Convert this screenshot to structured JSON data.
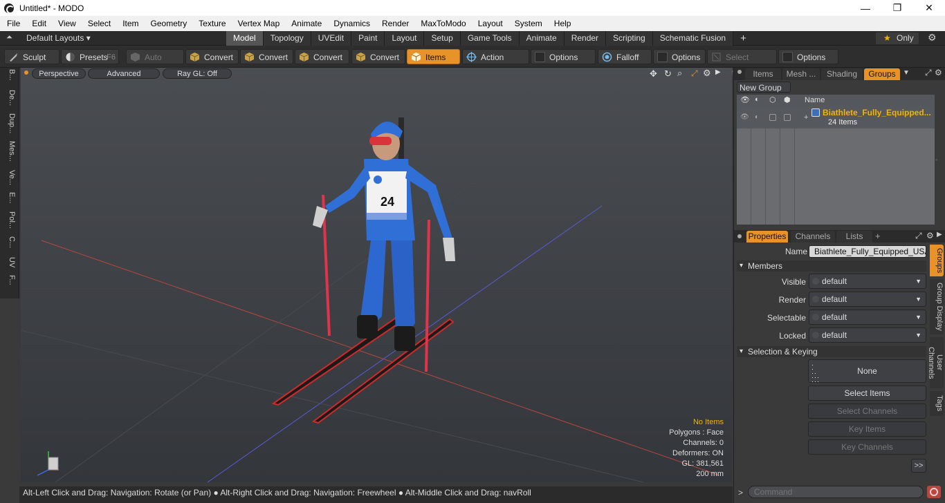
{
  "window": {
    "title": "Untitled* - MODO",
    "minimize": "—",
    "maximize": "❐",
    "close": "✕"
  },
  "menu": [
    "File",
    "Edit",
    "View",
    "Select",
    "Item",
    "Geometry",
    "Texture",
    "Vertex Map",
    "Animate",
    "Dynamics",
    "Render",
    "MaxToModo",
    "Layout",
    "System",
    "Help"
  ],
  "layoutbar": {
    "layouts_label": "Default Layouts ▾",
    "tabs": [
      "Model",
      "Topology",
      "UVEdit",
      "Paint",
      "Layout",
      "Setup",
      "Game Tools",
      "Animate",
      "Render",
      "Scripting",
      "Schematic Fusion"
    ],
    "active_tab": "Model",
    "add": "+",
    "only": "Only",
    "star": "★"
  },
  "toolbar": {
    "sculpt": "Sculpt",
    "presets": "Presets",
    "presets_key": "F6",
    "auto_select": "Auto Select",
    "convert1": "Convert",
    "convert2": "Convert",
    "convert3": "Convert",
    "convert4": "Convert",
    "items": "Items",
    "action_center": "Action Center",
    "options1": "Options",
    "falloff": "Falloff",
    "options2": "Options",
    "select_through": "Select Through",
    "options3": "Options"
  },
  "lefttabs": [
    "B...",
    "De...",
    "Dup...",
    "Mes...",
    "Ve...",
    "E...",
    "Pol...",
    "C...",
    "UV",
    "F..."
  ],
  "viewport": {
    "perspective": "Perspective",
    "advanced": "Advanced",
    "raygl": "Ray GL: Off",
    "bib_number": "24",
    "info": {
      "items": "No Items",
      "polygons": "Polygons : Face",
      "channels": "Channels: 0",
      "deformers": "Deformers: ON",
      "gl": "GL: 381,561",
      "scale": "200 mm"
    }
  },
  "statusbar": "Alt-Left Click and Drag: Navigation: Rotate (or Pan) ● Alt-Right Click and Drag: Navigation: Freewheel ● Alt-Middle Click and Drag: navRoll",
  "groups_panel": {
    "tabs": [
      "Items",
      "Mesh ...",
      "Shading",
      "Groups"
    ],
    "active_tab": "Groups",
    "new_group": "New Group",
    "col_name": "Name",
    "row_name": "Biathlete_Fully_Equipped...",
    "row_count": "24 Items"
  },
  "properties_panel": {
    "tabs": [
      "Properties",
      "Channels",
      "Lists"
    ],
    "active_tab": "Properties",
    "name_label": "Name",
    "name_value": "Biathlete_Fully_Equipped_USA_T",
    "members": "Members",
    "visible_label": "Visible",
    "visible_value": "default",
    "render_label": "Render",
    "render_value": "default",
    "selectable_label": "Selectable",
    "selectable_value": "default",
    "locked_label": "Locked",
    "locked_value": "default",
    "sel_keying": "Selection & Keying",
    "none": "None",
    "select_items": "Select Items",
    "select_channels": "Select Channels",
    "key_items": "Key Items",
    "key_channels": "Key Channels",
    "more": ">>",
    "side_tabs": [
      "Groups",
      "Group Display",
      "User Channels",
      "Tags"
    ]
  },
  "command": {
    "placeholder": "Command",
    "prompt": ">"
  },
  "colors": {
    "accent": "#e8922a",
    "highlight": "#f4b400",
    "suit_blue": "#2f6fd6"
  }
}
